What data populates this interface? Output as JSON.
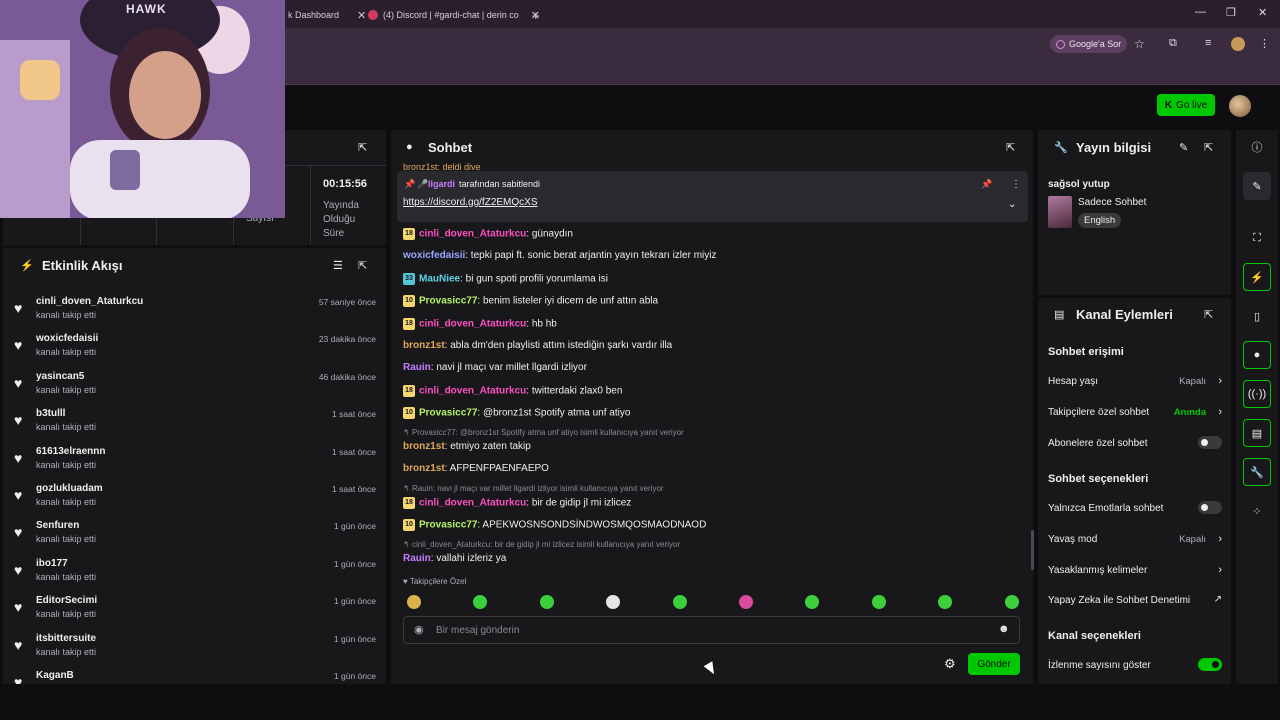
{
  "browser": {
    "tabs": [
      {
        "label": "k Dashboard"
      },
      {
        "label": "(4) Discord | #gardi-chat | derin co"
      }
    ],
    "google_sor": "Google'a Sor"
  },
  "webcam": {
    "shirt_text": "HAWK"
  },
  "dashboard": {
    "go_live": "Go live"
  },
  "stats": {
    "time": "00:15:56",
    "time_label": "Yayında Olduğu Süre",
    "count_label": "Sayısı"
  },
  "activity": {
    "title": "Etkinlik Akışı",
    "items": [
      {
        "name": "cinli_doven_Ataturkcu",
        "action": "kanalı takip etti",
        "time": "57 saniye önce"
      },
      {
        "name": "woxicfedaisii",
        "action": "kanalı takip etti",
        "time": "23 dakika önce"
      },
      {
        "name": "yasincan5",
        "action": "kanalı takip etti",
        "time": "46 dakika önce"
      },
      {
        "name": "b3tulll",
        "action": "kanalı takip etti",
        "time": "1 saat önce"
      },
      {
        "name": "61613elraennn",
        "action": "kanalı takip etti",
        "time": "1 saat önce"
      },
      {
        "name": "gozlukluadam",
        "action": "kanalı takip etti",
        "time": "1 saat önce"
      },
      {
        "name": "Senfuren",
        "action": "kanalı takip etti",
        "time": "1 gün önce"
      },
      {
        "name": "ibo177",
        "action": "kanalı takip etti",
        "time": "1 gün önce"
      },
      {
        "name": "EditorSecimi",
        "action": "kanalı takip etti",
        "time": "1 gün önce"
      },
      {
        "name": "itsbittersuite",
        "action": "kanalı takip etti",
        "time": "1 gün önce"
      },
      {
        "name": "KaganB",
        "action": "",
        "time": "1 gün önce"
      }
    ]
  },
  "chat": {
    "title": "Sohbet",
    "pinned_by_user": "llgardi",
    "pinned_by_text": "tarafından sabitlendi",
    "pinned_link": "https://discord.gg/fZ2EMQcXS",
    "partial_top": "bronz1st: deldi diye",
    "messages": [
      {
        "badge": "18",
        "badge_color": "#f5d76e",
        "user": "cinli_doven_Ataturkcu",
        "color": "#ff4ec3",
        "text": ": günaydın"
      },
      {
        "badge": "",
        "badge_color": "",
        "user": "woxicfedaisii",
        "color": "#9aa7ff",
        "text": ": tepki papi ft. sonic berat arjantin yayın tekrarı izler miyiz"
      },
      {
        "badge": "33",
        "badge_color": "#55c7d9",
        "user": "MauNiee",
        "color": "#5fd3e6",
        "text": ": bi gun spoti profili yorumlama isi"
      },
      {
        "badge": "10",
        "badge_color": "#f5d76e",
        "user": "Provasicc77",
        "color": "#b6f26a",
        "text": ": benim listeler iyi dicem de unf attın abla"
      },
      {
        "badge": "18",
        "badge_color": "#f5d76e",
        "user": "cinli_doven_Ataturkcu",
        "color": "#ff4ec3",
        "text": ": hb hb"
      },
      {
        "badge": "",
        "badge_color": "",
        "user": "bronz1st",
        "color": "#e0a85a",
        "text": ": abla dm'den playlisti attım istediğin şarkı vardır illa"
      },
      {
        "badge": "",
        "badge_color": "",
        "user": "Rauin",
        "color": "#c77dff",
        "text": ": navi jl maçı var millet llgardi izliyor"
      },
      {
        "badge": "18",
        "badge_color": "#f5d76e",
        "user": "cinli_doven_Ataturkcu",
        "color": "#ff4ec3",
        "text": ": twitterdaki zlax0 ben"
      },
      {
        "badge": "10",
        "badge_color": "#f5d76e",
        "user": "Provasicc77",
        "color": "#b6f26a",
        "text": ": @bronz1st Spotify atma unf atiyo"
      },
      {
        "badge": "",
        "badge_color": "",
        "user": "bronz1st",
        "color": "#e0a85a",
        "text": ": etmiyo zaten takip"
      },
      {
        "badge": "",
        "badge_color": "",
        "user": "bronz1st",
        "color": "#e0a85a",
        "text": ": AFPENFPAENFAEPO"
      },
      {
        "badge": "18",
        "badge_color": "#f5d76e",
        "user": "cinli_doven_Ataturkcu",
        "color": "#ff4ec3",
        "text": ": bir de gidip jl mi izlicez"
      },
      {
        "badge": "10",
        "badge_color": "#f5d76e",
        "user": "Provasicc77",
        "color": "#b6f26a",
        "text": ": APEKWOSNSONDSİNDWOSMQOSMAODNAOD"
      },
      {
        "badge": "",
        "badge_color": "",
        "user": "Rauin",
        "color": "#c77dff",
        "text": ": vallahi izleriz ya"
      }
    ],
    "replies": [
      "Provasicc77: @bronz1st Spotify atma unf atiyo isimli kullanıcıya yanıt veriyor",
      "Rauin: navi jl maçı var millet llgardi izliyor isimli kullanıcıya yanıt veriyor",
      "cinli_doven_Ataturkcu: bir de gidip jl mi izlicez isimli kullanıcıya yanıt veriyor"
    ],
    "followers_only": "Takipçilere Özel",
    "input_placeholder": "Bir mesaj gönderin",
    "send": "Gönder"
  },
  "stream_info": {
    "title": "Yayın bilgisi",
    "stream_title": "sağsol yutup",
    "category": "Sadece Sohbet",
    "language": "English"
  },
  "channel_actions": {
    "title": "Kanal Eylemleri",
    "chat_access": "Sohbet erişimi",
    "rows1": [
      {
        "label": "Hesap yaşı",
        "value": "Kapalı"
      },
      {
        "label": "Takipçilere özel sohbet",
        "value": "Anında"
      },
      {
        "label": "Abonelere özel sohbet",
        "value": ""
      }
    ],
    "chat_options": "Sohbet seçenekleri",
    "rows2": [
      {
        "label": "Yalnızca Emotlarla sohbet",
        "value": ""
      },
      {
        "label": "Yavaş mod",
        "value": "Kapalı"
      },
      {
        "label": "Yasaklanmış kelimeler",
        "value": ""
      },
      {
        "label": "Yapay Zeka ile Sohbet Denetimi",
        "value": ""
      }
    ],
    "channel_options": "Kanal seçenekleri",
    "show_viewers": "İzlenme sayısını göster"
  },
  "colors": {
    "accent": "#00c800",
    "bg": "#0e0e10",
    "panel": "#18181b"
  }
}
